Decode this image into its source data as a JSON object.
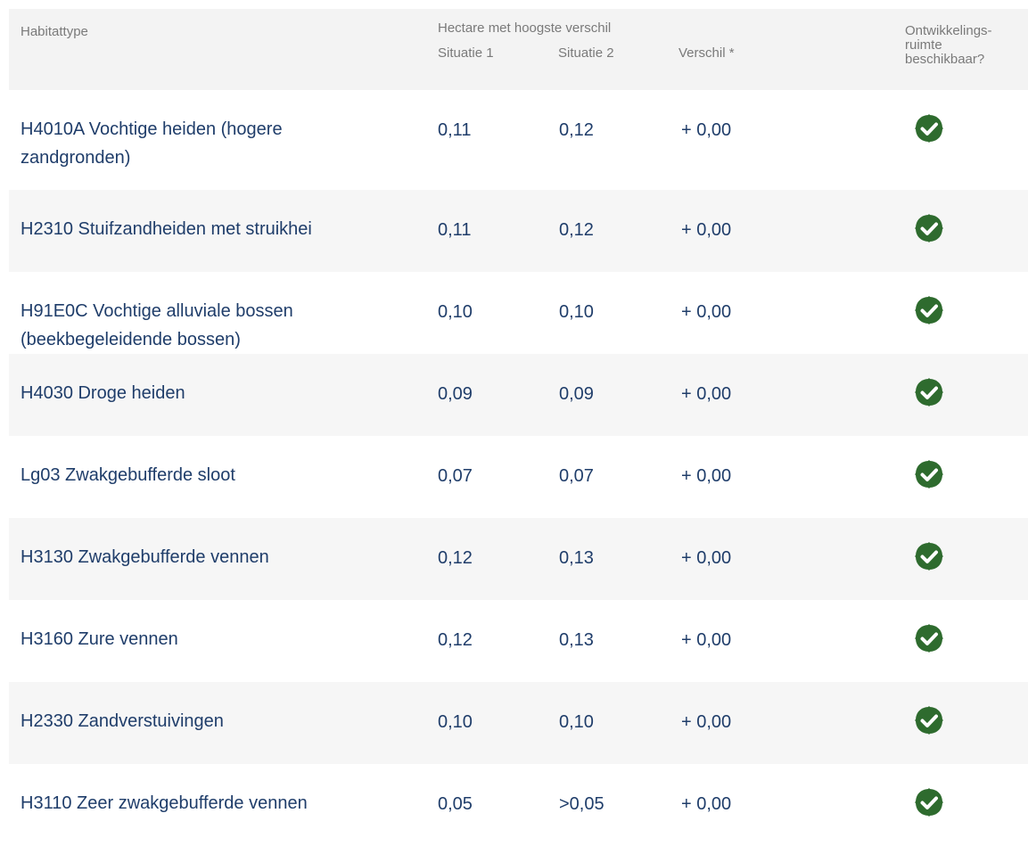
{
  "header": {
    "habitat": "Habitattype",
    "group": "Hectare met hoogste verschil",
    "situatie1": "Situatie 1",
    "situatie2": "Situatie 2",
    "verschil": "Verschil *",
    "dev_line1": "Ontwikkelings-",
    "dev_line2": "ruimte",
    "dev_line3": "beschikbaar?"
  },
  "rows": [
    {
      "name": "H4010A Vochtige heiden (hogere zandgronden)",
      "s1": "0,11",
      "s2": "0,12",
      "diff": "+ 0,00",
      "available": "check-icon"
    },
    {
      "name": "H2310 Stuifzandheiden met struikhei",
      "s1": "0,11",
      "s2": "0,12",
      "diff": "+ 0,00",
      "available": "check-icon"
    },
    {
      "name": "H91E0C Vochtige alluviale bossen (beekbegeleidende bossen)",
      "s1": "0,10",
      "s2": "0,10",
      "diff": "+ 0,00",
      "available": "check-icon"
    },
    {
      "name": "H4030 Droge heiden",
      "s1": "0,09",
      "s2": "0,09",
      "diff": "+ 0,00",
      "available": "check-icon"
    },
    {
      "name": "Lg03 Zwakgebufferde sloot",
      "s1": "0,07",
      "s2": "0,07",
      "diff": "+ 0,00",
      "available": "check-icon"
    },
    {
      "name": "H3130 Zwakgebufferde vennen",
      "s1": "0,12",
      "s2": "0,13",
      "diff": "+ 0,00",
      "available": "check-icon"
    },
    {
      "name": "H3160 Zure vennen",
      "s1": "0,12",
      "s2": "0,13",
      "diff": "+ 0,00",
      "available": "check-icon"
    },
    {
      "name": "H2330 Zandverstuivingen",
      "s1": "0,10",
      "s2": "0,10",
      "diff": "+ 0,00",
      "available": "check-icon"
    },
    {
      "name": "H3110 Zeer zwakgebufferde vennen",
      "s1": "0,05",
      "s2": ">0,05",
      "diff": "+ 0,00",
      "available": "check-icon"
    }
  ],
  "colors": {
    "text": "#1f3d6a",
    "header_text": "#7a7a7a",
    "check_bg": "#2e6b2e",
    "row_alt": "#f6f6f6"
  }
}
